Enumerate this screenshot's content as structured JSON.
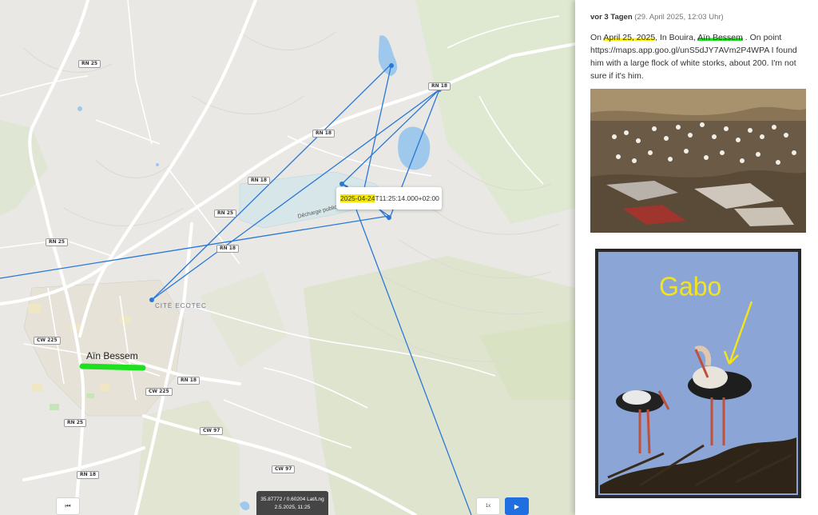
{
  "map": {
    "road_labels": [
      {
        "id": "rn25-a",
        "text": "RN 25"
      },
      {
        "id": "rn18-a",
        "text": "RN 18"
      },
      {
        "id": "rn18-b",
        "text": "RN 18"
      },
      {
        "id": "rn18-c",
        "text": "RN 18"
      },
      {
        "id": "rn25-b",
        "text": "RN 25"
      },
      {
        "id": "rn25-c",
        "text": "RN 25"
      },
      {
        "id": "rn18-d",
        "text": "RN 18"
      },
      {
        "id": "cw225-a",
        "text": "CW 225"
      },
      {
        "id": "rn18-e",
        "text": "RN 18"
      },
      {
        "id": "cw225-b",
        "text": "CW 225"
      },
      {
        "id": "rn25-d",
        "text": "RN 25"
      },
      {
        "id": "cw97-a",
        "text": "CW 97"
      },
      {
        "id": "cw97-b",
        "text": "CW 97"
      },
      {
        "id": "rn18-f",
        "text": "RN 18"
      }
    ],
    "place_label": "CITÉ ECOTEC",
    "area_label": "Décharge publique",
    "city_label": "Aïn Bessem",
    "tooltip": {
      "date": "2025-04-24",
      "time": "T11:25:14.000+02:00"
    },
    "coords": {
      "line1": "35.87772 / 0.60204 Lat/Lng",
      "line2": "2.5.2025, 11:25"
    },
    "controls": {
      "prev": "⏮",
      "speed": "1x",
      "play": "▶"
    }
  },
  "panel": {
    "meta_when": "vor 3 Tagen",
    "meta_date": "(29. April 2025, 12:03 Uhr)",
    "post": {
      "t1": "On ",
      "date": "April 25, 2025",
      "t2": ", In Bouira, ",
      "place": "Aïn Bessem",
      "t3": " . On point https://maps.app.goo.gl/unS5dJY7AVm2P4WPA I found him with a large flock of white storks, about 200. I'm not sure if it's him."
    },
    "photo2_annotation": "Gabo"
  },
  "colors": {
    "track": "#2a78d6",
    "water": "#9ec8ec",
    "highlight_yellow": "#f7ee1a",
    "highlight_green": "#1fe01f",
    "play_button": "#1f6fe0"
  }
}
